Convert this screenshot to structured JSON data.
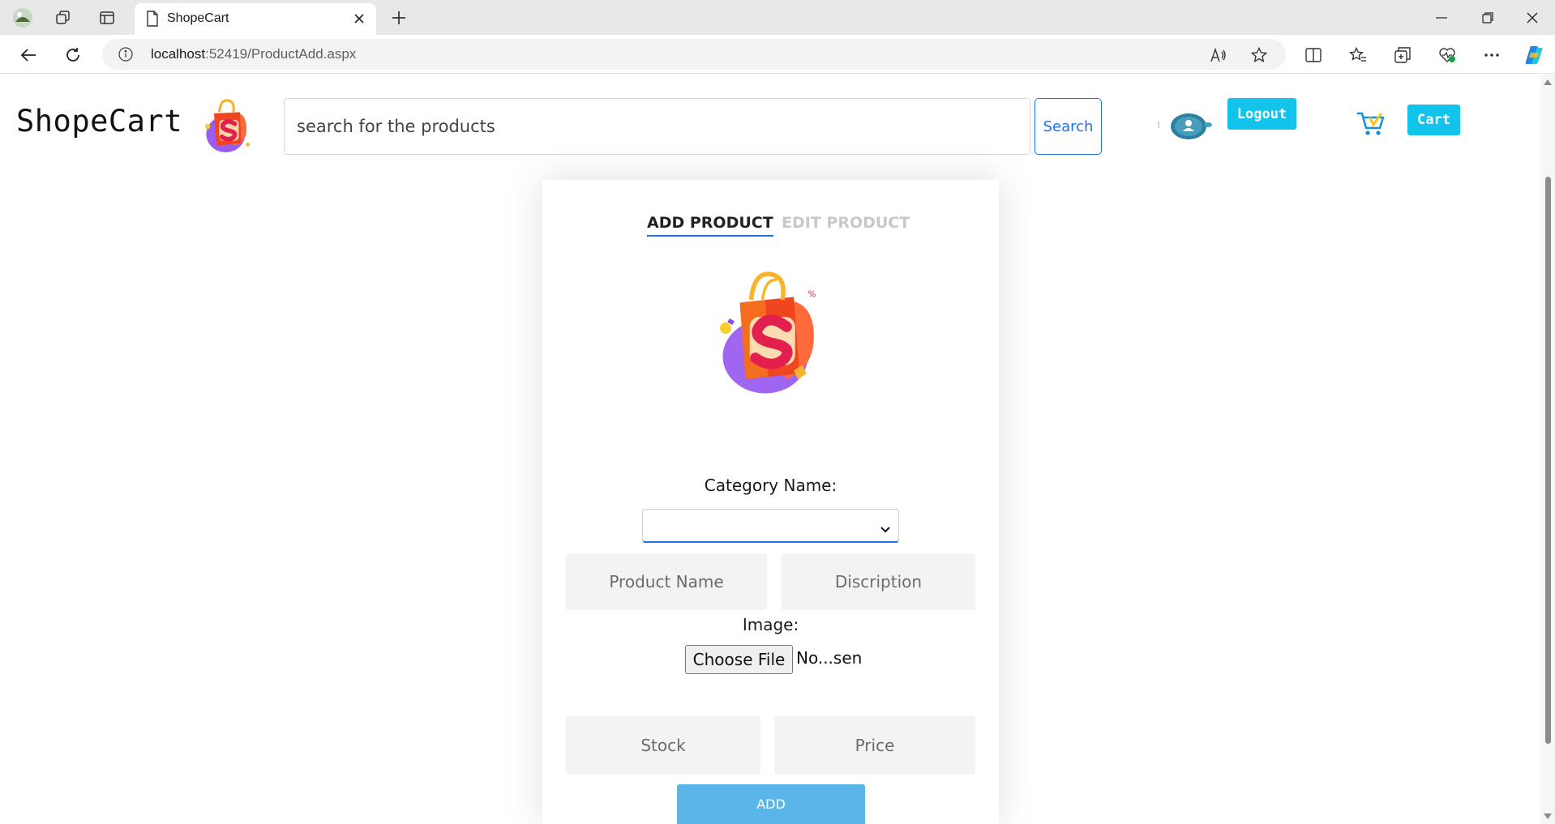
{
  "browser": {
    "tab_title": "ShopeCart",
    "url_host": "localhost",
    "url_rest": ":52419/ProductAdd.aspx"
  },
  "header": {
    "brand": "ShopeCart",
    "search_placeholder": "search for the products",
    "search_label": "Search",
    "logout_label": "Logout",
    "cart_label": "Cart"
  },
  "form": {
    "tab_add": "ADD PRODUCT",
    "tab_edit": "EDIT PRODUCT",
    "category_label": "Category Name:",
    "category_selected": "",
    "product_name_placeholder": "Product Name",
    "description_placeholder": "Discription",
    "image_label": "Image:",
    "choose_file_label": "Choose File",
    "file_status": "No...sen",
    "stock_placeholder": "Stock",
    "price_placeholder": "Price",
    "add_label": "ADD"
  },
  "colors": {
    "accent_cyan": "#12c4ec",
    "link_blue": "#1a73e8",
    "add_button": "#5ab6e8"
  }
}
